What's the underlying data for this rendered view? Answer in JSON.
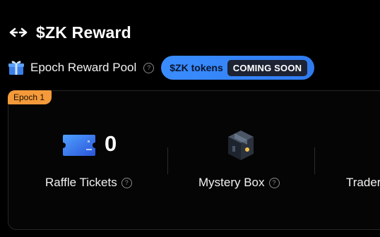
{
  "header": {
    "title": "$ZK Reward",
    "icon": "swap-arrows-icon"
  },
  "reward_pool": {
    "icon": "gift-icon",
    "label": "Epoch Reward Pool",
    "help_icon": "question-circle-icon",
    "token_label": "$ZK tokens",
    "status_badge": "COMING SOON",
    "accent_color": "#3a8dff"
  },
  "epoch": {
    "tab_label": "Epoch 1",
    "tab_color": "#f59a3a",
    "stats": [
      {
        "label": "Raffle Tickets",
        "value": "0",
        "icon": "raffle-ticket-icon"
      },
      {
        "label": "Mystery Box",
        "icon": "mystery-box-icon"
      },
      {
        "label": "Trader"
      }
    ]
  }
}
